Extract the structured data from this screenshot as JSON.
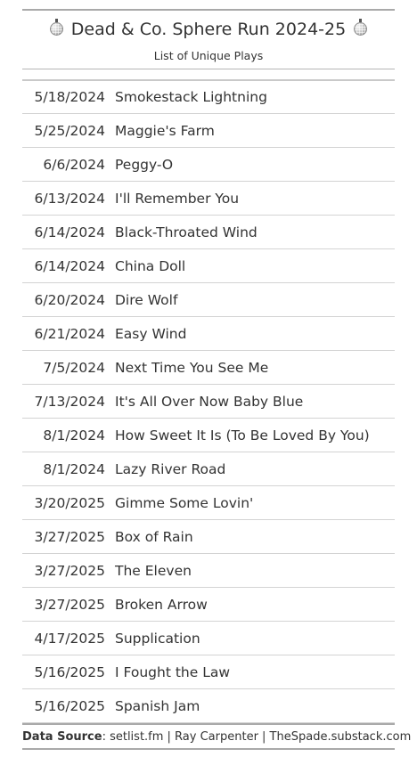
{
  "header": {
    "title": "Dead & Co. Sphere Run 2024-25",
    "subtitle": "List of Unique Plays",
    "icon": "disco-ball-icon"
  },
  "plays": [
    {
      "date": "5/18/2024",
      "song": "Smokestack Lightning"
    },
    {
      "date": "5/25/2024",
      "song": "Maggie's Farm"
    },
    {
      "date": "6/6/2024",
      "song": "Peggy-O"
    },
    {
      "date": "6/13/2024",
      "song": "I'll Remember You"
    },
    {
      "date": "6/14/2024",
      "song": "Black-Throated Wind"
    },
    {
      "date": "6/14/2024",
      "song": "China Doll"
    },
    {
      "date": "6/20/2024",
      "song": "Dire Wolf"
    },
    {
      "date": "6/21/2024",
      "song": "Easy Wind"
    },
    {
      "date": "7/5/2024",
      "song": "Next Time You See Me"
    },
    {
      "date": "7/13/2024",
      "song": "It's All Over Now Baby Blue"
    },
    {
      "date": "8/1/2024",
      "song": "How Sweet It Is (To Be Loved By You)"
    },
    {
      "date": "8/1/2024",
      "song": "Lazy River Road"
    },
    {
      "date": "3/20/2025",
      "song": "Gimme Some Lovin'"
    },
    {
      "date": "3/27/2025",
      "song": "Box of Rain"
    },
    {
      "date": "3/27/2025",
      "song": "The Eleven"
    },
    {
      "date": "3/27/2025",
      "song": "Broken Arrow"
    },
    {
      "date": "4/17/2025",
      "song": "Supplication"
    },
    {
      "date": "5/16/2025",
      "song": "I Fought the Law"
    },
    {
      "date": "5/16/2025",
      "song": "Spanish Jam"
    }
  ],
  "footer": {
    "label": "Data Source",
    "text": ": setlist.fm | Ray Carpenter | TheSpade.substack.com"
  }
}
